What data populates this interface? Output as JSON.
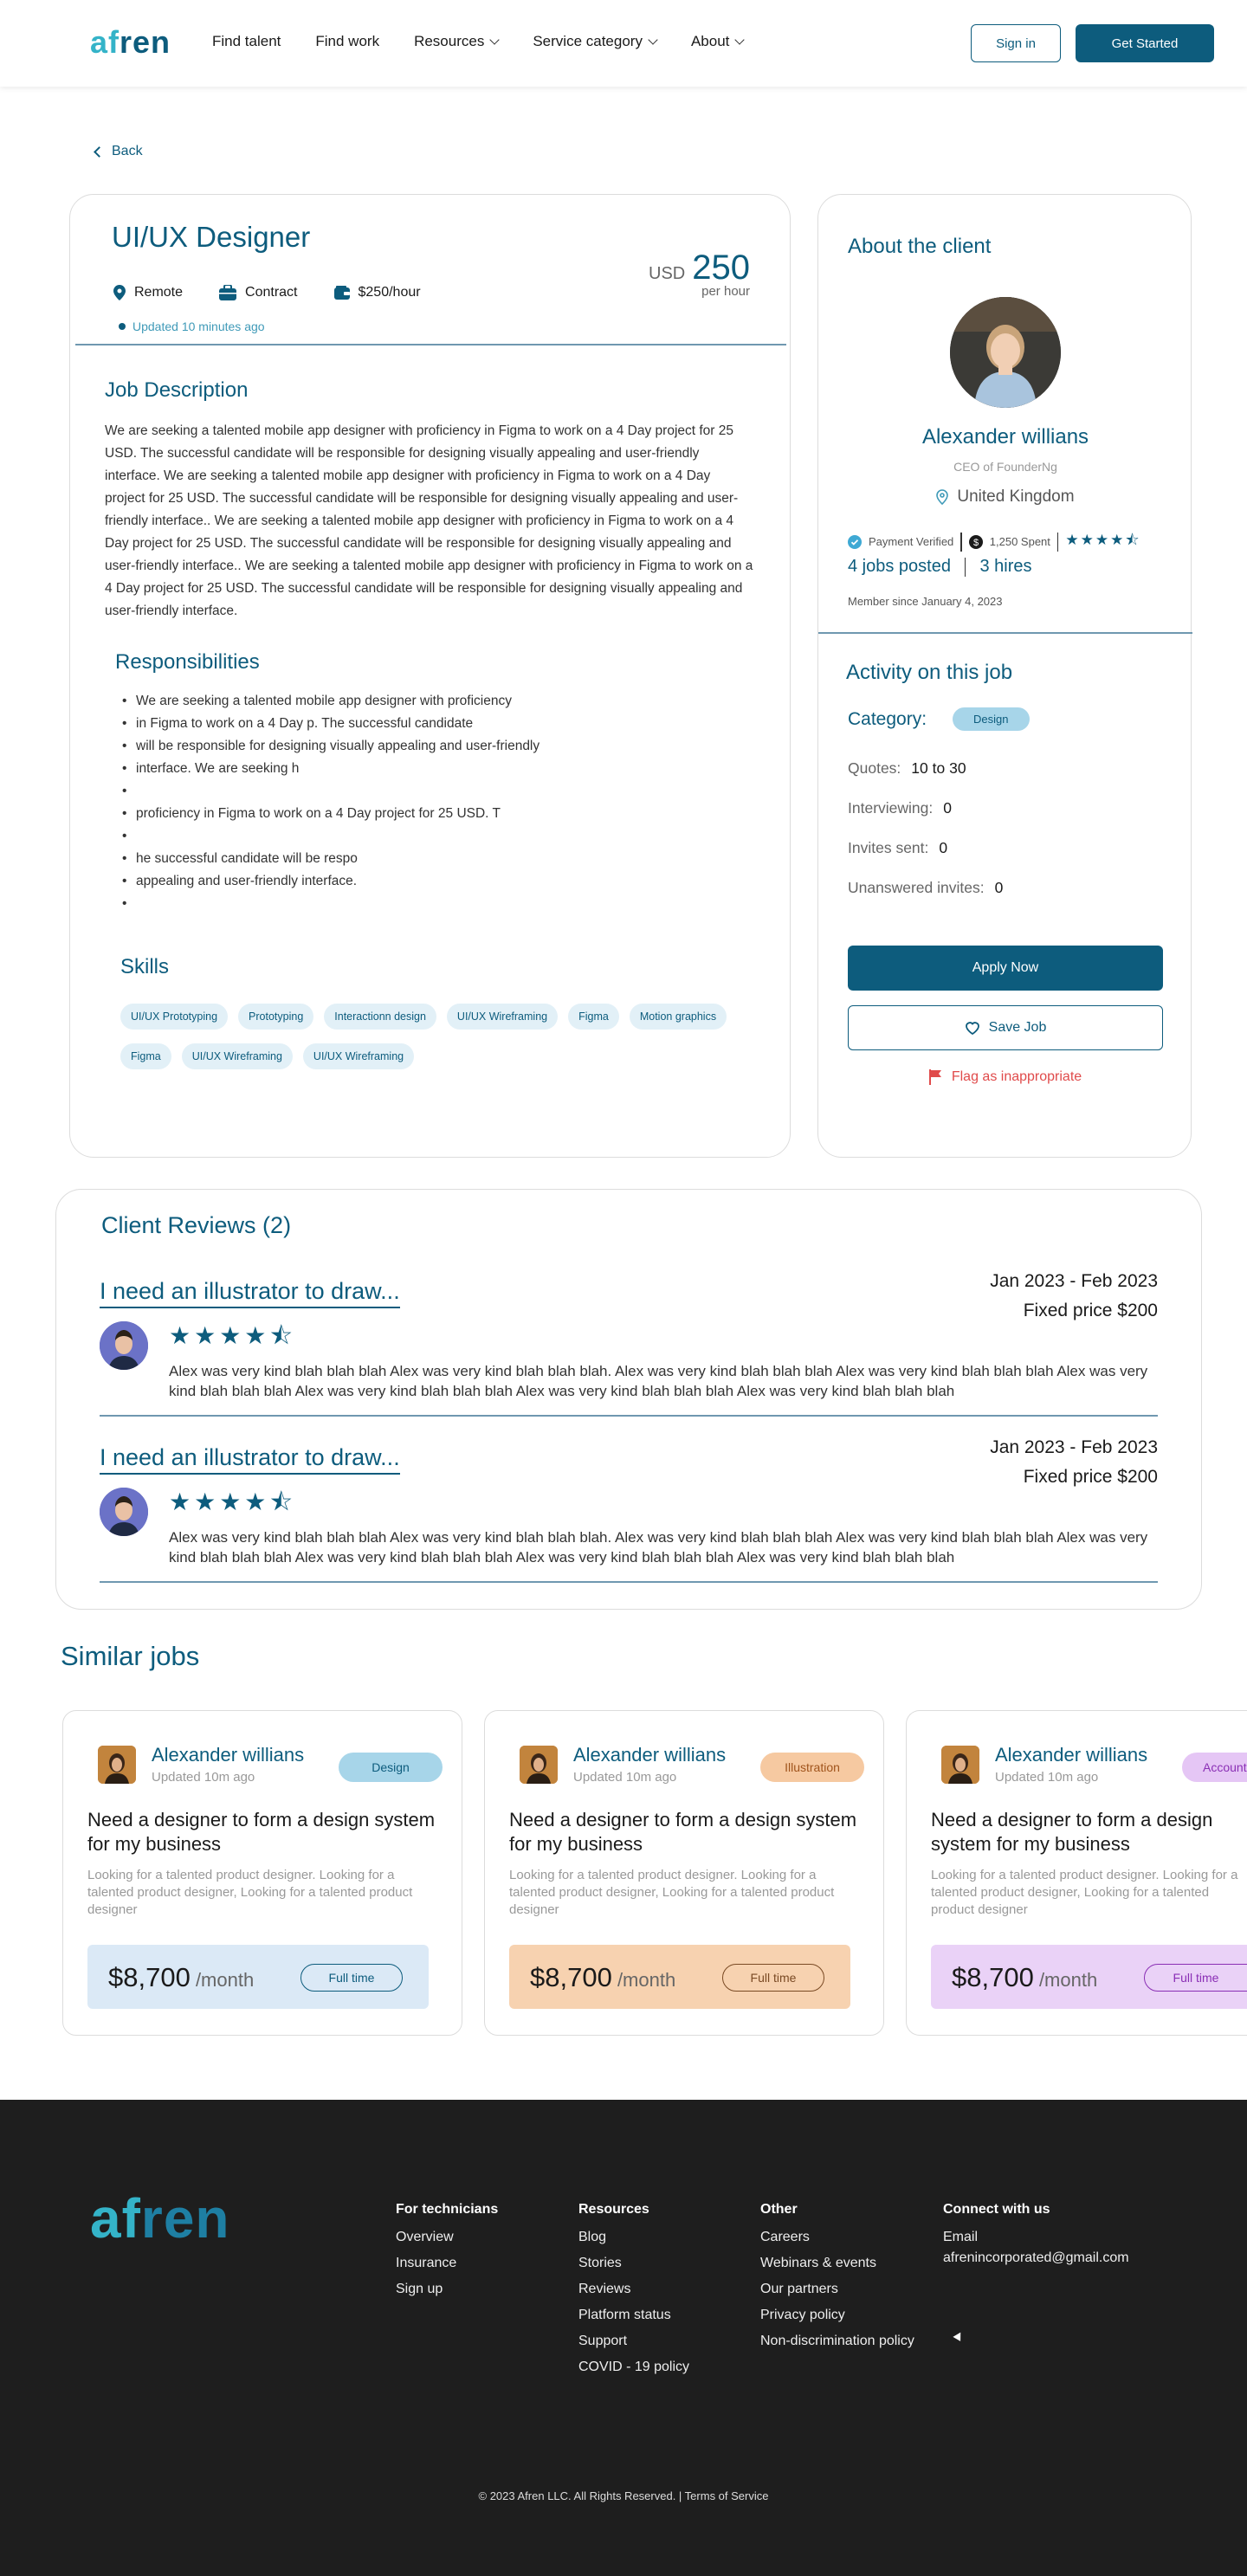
{
  "nav": {
    "logo_part1": "af",
    "logo_part2": "ren",
    "links": [
      "Find talent",
      "Find work",
      "Resources",
      "Service category",
      "About"
    ],
    "signin": "Sign in",
    "get_started": "Get Started"
  },
  "back": "Back",
  "job": {
    "title": "UI/UX Designer",
    "location": "Remote",
    "type": "Contract",
    "rate": "$250/hour",
    "updated": "Updated 10 minutes ago",
    "currency": "USD",
    "amount": "250",
    "per": "per hour",
    "desc_title": "Job Description",
    "description": "We are seeking a talented mobile app designer with proficiency in Figma to work on a 4 Day project for 25 USD. The successful candidate will be responsible for designing visually appealing and user-friendly interface. We are seeking a talented mobile app designer with proficiency in Figma to work on a 4 Day project for 25 USD. The successful candidate will be responsible for designing visually appealing and user-friendly interface.. We are seeking a talented mobile app designer with proficiency in Figma to work on a 4 Day project for 25 USD. The successful candidate will be responsible for designing visually appealing and user-friendly interface.. We are seeking a talented mobile app designer with proficiency in Figma to work on a 4 Day project for 25 USD. The successful candidate will be responsible for designing visually appealing and user-friendly interface.",
    "resp_title": "Responsibilities",
    "responsibilities": [
      "We are seeking a talented mobile app designer with proficiency",
      "in Figma to work on a 4 Day p. The successful candidate",
      " will be responsible for designing visually appealing and user-friendly",
      "interface. We are seeking h",
      "",
      "proficiency in Figma to work on a 4 Day project for 25 USD. T",
      "",
      "he successful candidate will be respo",
      "appealing and user-friendly interface.",
      ""
    ],
    "skills_title": "Skills",
    "skills": [
      "UI/UX Prototyping",
      "Prototyping",
      "Interactionn design",
      "UI/UX Wireframing",
      "Figma",
      "Motion graphics",
      "Figma",
      "UI/UX Wireframing",
      "UI/UX Wireframing"
    ]
  },
  "client": {
    "about_title": "About the client",
    "name": "Alexander willians",
    "role": "CEO of FounderNg",
    "location": "United Kingdom",
    "payment": "Payment Verified",
    "spent": "1,250 Spent",
    "rating_stars": "★★★★⯪",
    "jobs_posted": "4 jobs posted",
    "hires": "3 hires",
    "member_since": "Member since January 4, 2023",
    "activity_title": "Activity on this job",
    "category_label": "Category:",
    "category": "Design",
    "quotes_label": "Quotes:",
    "quotes": "10 to 30",
    "interviewing_label": "Interviewing:",
    "interviewing": "0",
    "invites_label": "Invites sent:",
    "invites": "0",
    "unanswered_label": "Unanswered invites:",
    "unanswered": "0",
    "apply": "Apply Now",
    "save": "Save Job",
    "flag": "Flag as inappropriate"
  },
  "reviews": {
    "title": "Client Reviews (2)",
    "items": [
      {
        "title": "I need an illustrator to draw...",
        "date": "Jan 2023 - Feb 2023",
        "price": "Fixed price $200",
        "stars": "★★★★⯪",
        "text": "Alex was very kind blah blah blah Alex was very kind blah blah blah. Alex was very kind blah blah blah Alex was very kind blah blah blah Alex was very kind blah blah blah Alex was very kind blah blah blah Alex was very kind blah blah blah Alex was very kind blah blah blah"
      },
      {
        "title": "I need an illustrator to draw...",
        "date": "Jan 2023 - Feb 2023",
        "price": "Fixed price $200",
        "stars": "★★★★⯪",
        "text": "Alex was very kind blah blah blah Alex was very kind blah blah blah. Alex was very kind blah blah blah Alex was very kind blah blah blah Alex was very kind blah blah blah Alex was very kind blah blah blah Alex was very kind blah blah blah Alex was very kind blah blah blah"
      }
    ]
  },
  "similar": {
    "title": "Similar jobs",
    "cards": [
      {
        "name": "Alexander willians",
        "updated": "Updated 10m ago",
        "tag": "Design",
        "tag_bg": "#a7d5e9",
        "tag_fg": "#0d5c7d",
        "heading": "Need a designer to form a design system for my business",
        "desc": "Looking for a talented product designer. Looking for a talented product designer, Looking for a talented product designer",
        "amount": "$8,700",
        "per": " /month",
        "jobtype": "Full time",
        "box_bg": "#dbe9f6",
        "ft_border": "#0d5c7d",
        "ft_fg": "#0d5c7d"
      },
      {
        "name": "Alexander willians",
        "updated": "Updated 10m ago",
        "tag": "Illustration",
        "tag_bg": "#f6c9a1",
        "tag_fg": "#a0541c",
        "heading": "Need a designer to form a design system for my business",
        "desc": "Looking for a talented product designer. Looking for a talented product designer, Looking for a talented product designer",
        "amount": "$8,700",
        "per": " /month",
        "jobtype": "Full time",
        "box_bg": "#f7d2b0",
        "ft_border": "#7a4a24",
        "ft_fg": "#7a4a24"
      },
      {
        "name": "Alexander willians",
        "updated": "Updated 10m ago",
        "tag": "Account",
        "tag_bg": "#e5c6f5",
        "tag_fg": "#8a2fb5",
        "heading": "Need a designer to form a design system for my business",
        "desc": "Looking for a talented product designer. Looking for a talented product designer, Looking for a talented product designer",
        "amount": "$8,700",
        "per": " /month",
        "jobtype": "Full time",
        "box_bg": "#ead2f7",
        "ft_border": "#8a2fb5",
        "ft_fg": "#8a2fb5"
      }
    ]
  },
  "footer": {
    "logo_part1": "af",
    "logo_part2": "ren",
    "cols": [
      {
        "title": "For technicians",
        "items": [
          "Overview",
          "Insurance",
          "Sign up"
        ]
      },
      {
        "title": "Resources",
        "items": [
          "Blog",
          "Stories",
          "Reviews",
          "Platform status",
          "Support",
          "COVID - 19 policy"
        ]
      },
      {
        "title": "Other",
        "items": [
          "Careers",
          "Webinars & events",
          "Our partners",
          "Privacy policy",
          "Non-discrimination policy"
        ]
      },
      {
        "title": "Connect with us",
        "items": [
          "Email",
          "afrenincorporated@gmail.com"
        ]
      }
    ],
    "copyright": "© 2023 Afren  LLC. All Rights Reserved.  |  Terms of Service"
  }
}
